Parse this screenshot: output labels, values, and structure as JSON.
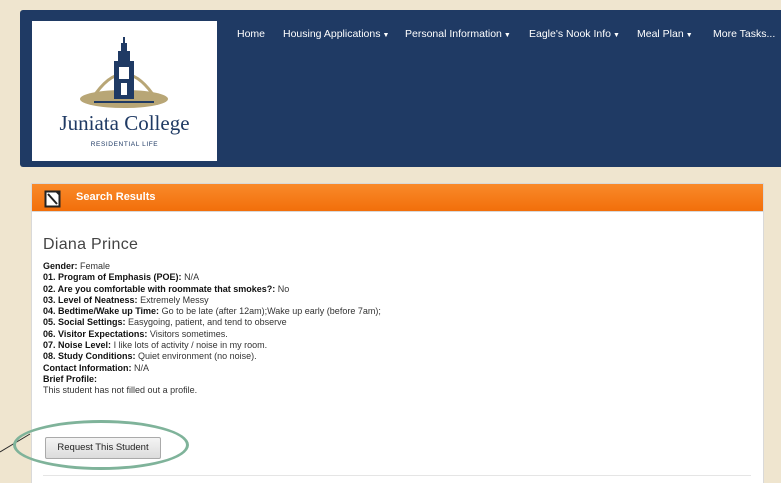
{
  "header": {
    "logo": {
      "title": "Juniata College",
      "subtitle": "RESIDENTIAL LIFE"
    },
    "nav": [
      {
        "label": "Home",
        "dropdown": false
      },
      {
        "label": "Housing Applications",
        "dropdown": true
      },
      {
        "label": "Personal Information",
        "dropdown": true
      },
      {
        "label": "Eagle's Nook Info",
        "dropdown": true
      },
      {
        "label": "Meal Plan",
        "dropdown": true
      },
      {
        "label": "More Tasks...",
        "dropdown": false
      }
    ]
  },
  "panel": {
    "title": "Search Results",
    "icon": "document-icon",
    "accent_color": "#f47a16"
  },
  "student": {
    "name": "Diana Prince",
    "fields": [
      {
        "label": "Gender:",
        "value": "Female"
      },
      {
        "label": "01. Program of Emphasis (POE):",
        "value": "N/A"
      },
      {
        "label": "02. Are you comfortable with roommate that smokes?:",
        "value": "No"
      },
      {
        "label": "03. Level of Neatness:",
        "value": "Extremely Messy"
      },
      {
        "label": "04. Bedtime/Wake up Time:",
        "value": "Go to be late (after 12am);Wake up early (before 7am);"
      },
      {
        "label": "05. Social Settings:",
        "value": "Easygoing, patient, and tend to observe"
      },
      {
        "label": "06. Visitor Expectations:",
        "value": "Visitors sometimes."
      },
      {
        "label": "07. Noise Level:",
        "value": "I like lots of activity / noise in my room."
      },
      {
        "label": "08. Study Conditions:",
        "value": "Quiet environment (no noise)."
      },
      {
        "label": "Contact Information:",
        "value": "N/A"
      },
      {
        "label": "Brief Profile:",
        "value": ""
      }
    ],
    "profile_text": "This student has not filled out a profile.",
    "request_label": "Request This Student"
  },
  "colors": {
    "header_bg": "#1f3a64",
    "page_bg": "#efe5cf",
    "highlight": "#7fb39a"
  }
}
